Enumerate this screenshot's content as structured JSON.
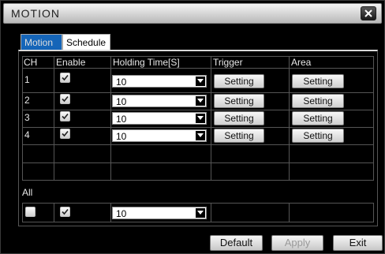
{
  "window": {
    "title": "MOTION"
  },
  "tabs": [
    {
      "label": "Motion",
      "active": true
    },
    {
      "label": "Schedule",
      "active": false
    }
  ],
  "table": {
    "headers": [
      "CH",
      "Enable",
      "Holding Time[S]",
      "Trigger",
      "Area"
    ],
    "rows": [
      {
        "ch": "1",
        "enabled": true,
        "holding_time": "10",
        "trigger_label": "Setting",
        "area_label": "Setting"
      },
      {
        "ch": "2",
        "enabled": true,
        "holding_time": "10",
        "trigger_label": "Setting",
        "area_label": "Setting"
      },
      {
        "ch": "3",
        "enabled": true,
        "holding_time": "10",
        "trigger_label": "Setting",
        "area_label": "Setting"
      },
      {
        "ch": "4",
        "enabled": true,
        "holding_time": "10",
        "trigger_label": "Setting",
        "area_label": "Setting"
      }
    ]
  },
  "all": {
    "label": "All",
    "select_all_checked": false,
    "enable_checked": true,
    "holding_time": "10"
  },
  "footer": {
    "default_label": "Default",
    "apply_label": "Apply",
    "exit_label": "Exit"
  },
  "colors": {
    "active_tab": "#1565b8",
    "background": "#000000"
  }
}
